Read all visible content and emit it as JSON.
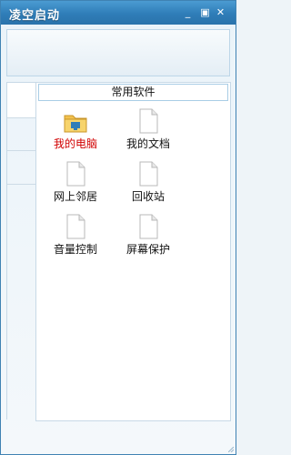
{
  "window": {
    "title": "凌空启动",
    "controls": {
      "minimize": "_",
      "restore": "▣",
      "close": "✕"
    }
  },
  "panel": {
    "category": "常用软件",
    "items": [
      {
        "label": "我的电脑",
        "icon": "computer-folder-icon",
        "selected": true
      },
      {
        "label": "我的文档",
        "icon": "document-icon"
      },
      {
        "label": "网上邻居",
        "icon": "document-icon"
      },
      {
        "label": "回收站",
        "icon": "document-icon"
      },
      {
        "label": "音量控制",
        "icon": "document-icon"
      },
      {
        "label": "屏幕保护",
        "icon": "document-icon"
      }
    ]
  },
  "colors": {
    "titlebar": "#2f7db8",
    "selected_text": "#d10000",
    "border": "#3f82b3"
  }
}
